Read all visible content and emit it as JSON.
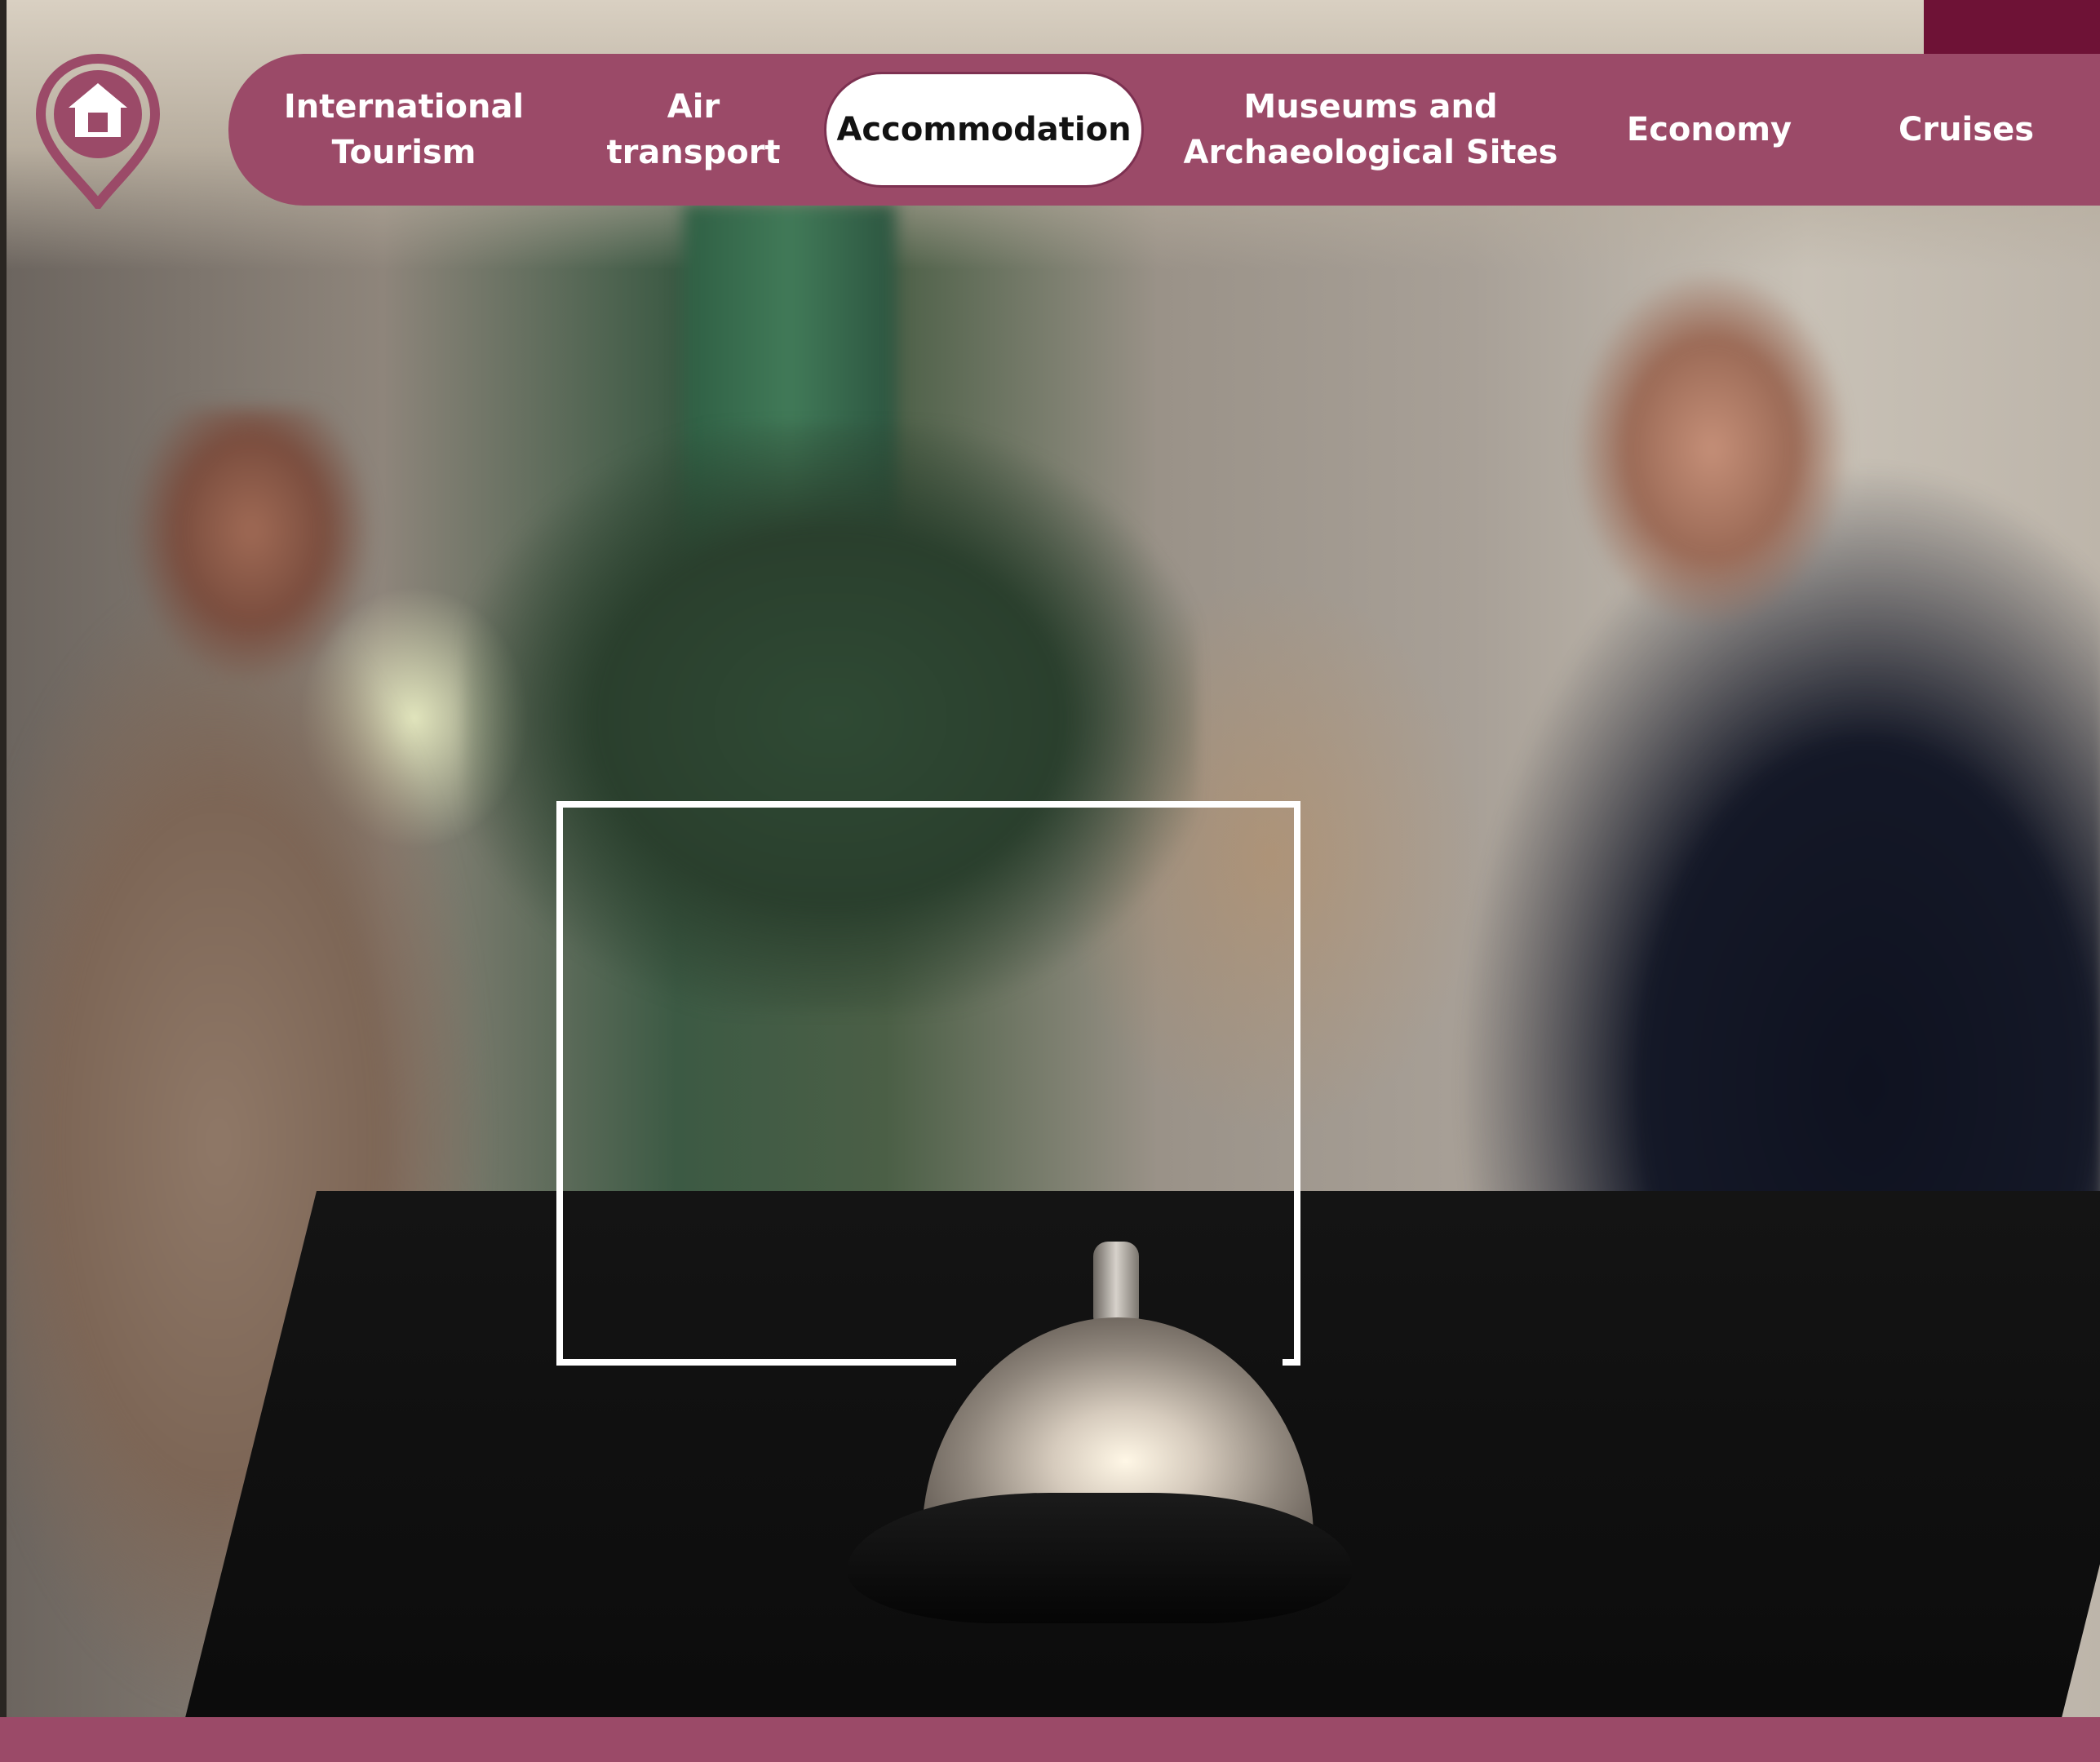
{
  "colors": {
    "brand": "#9b4a68",
    "accent_dark": "#6e1236",
    "active_tab_bg": "#ffffff",
    "active_tab_text": "#121212",
    "tab_text": "#ffffff"
  },
  "logo": {
    "icon": "home-pin-icon"
  },
  "nav": {
    "tabs": [
      {
        "label": "International\nTourism",
        "active": false
      },
      {
        "label": "Air\ntransport",
        "active": false
      },
      {
        "label": "Accommodation",
        "active": true
      },
      {
        "label": "Museums and\nArchaeological Sites",
        "active": false
      },
      {
        "label": "Economy",
        "active": false
      },
      {
        "label": "Cruises",
        "active": false
      }
    ]
  },
  "hero": {
    "image_subject": "hotel reception desk with service bell"
  }
}
